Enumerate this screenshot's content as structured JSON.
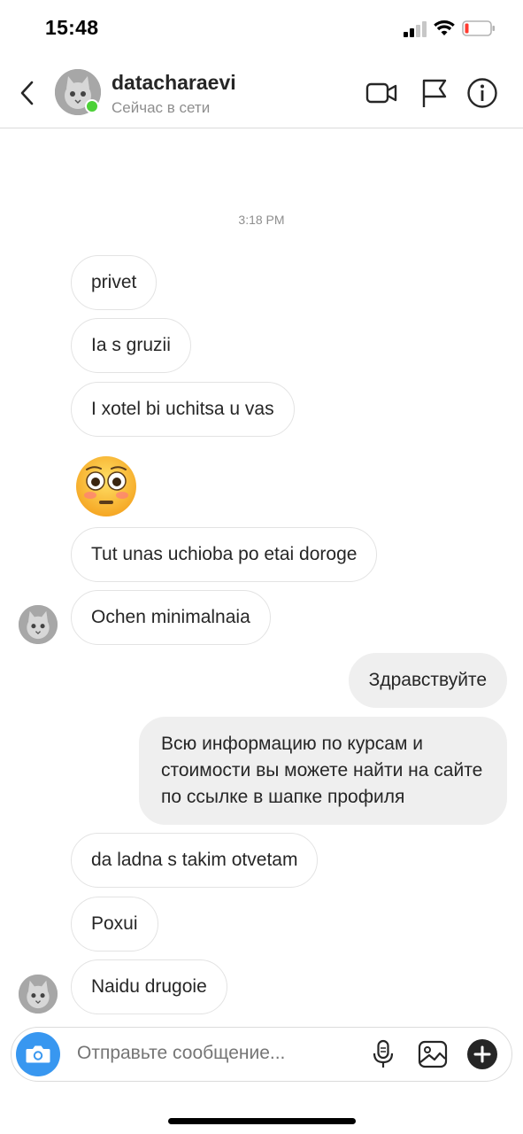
{
  "status_bar": {
    "time": "15:48"
  },
  "header": {
    "username": "datacharaevi",
    "presence": "Сейчас в сети"
  },
  "thread": {
    "timestamp": "3:18 PM",
    "messages": [
      {
        "direction": "incoming",
        "text": "privet"
      },
      {
        "direction": "incoming",
        "text": "Ia s gruzii"
      },
      {
        "direction": "incoming",
        "text": "I xotel bi uchitsa u vas"
      },
      {
        "direction": "incoming",
        "emoji": "flushed-face",
        "text": ""
      },
      {
        "direction": "incoming",
        "text": "Tut unas uchioba po etai doroge"
      },
      {
        "direction": "incoming",
        "text": "Ochen minimalnaia"
      },
      {
        "direction": "outgoing",
        "text": "Здравствуйте"
      },
      {
        "direction": "outgoing",
        "text": "Всю информацию по курсам и стоимости вы можете найти на сайте по ссылке в шапке профиля"
      },
      {
        "direction": "incoming",
        "text": "da ladna s takim otvetam"
      },
      {
        "direction": "incoming",
        "text": "Poxui"
      },
      {
        "direction": "incoming",
        "text": "Naidu drugoie"
      }
    ]
  },
  "composer": {
    "placeholder": "Отправьте сообщение..."
  },
  "colors": {
    "accent": "#3897f0",
    "online": "#4cd137",
    "outgoing_bubble": "#efefef",
    "battery_low": "#ff3b30"
  }
}
